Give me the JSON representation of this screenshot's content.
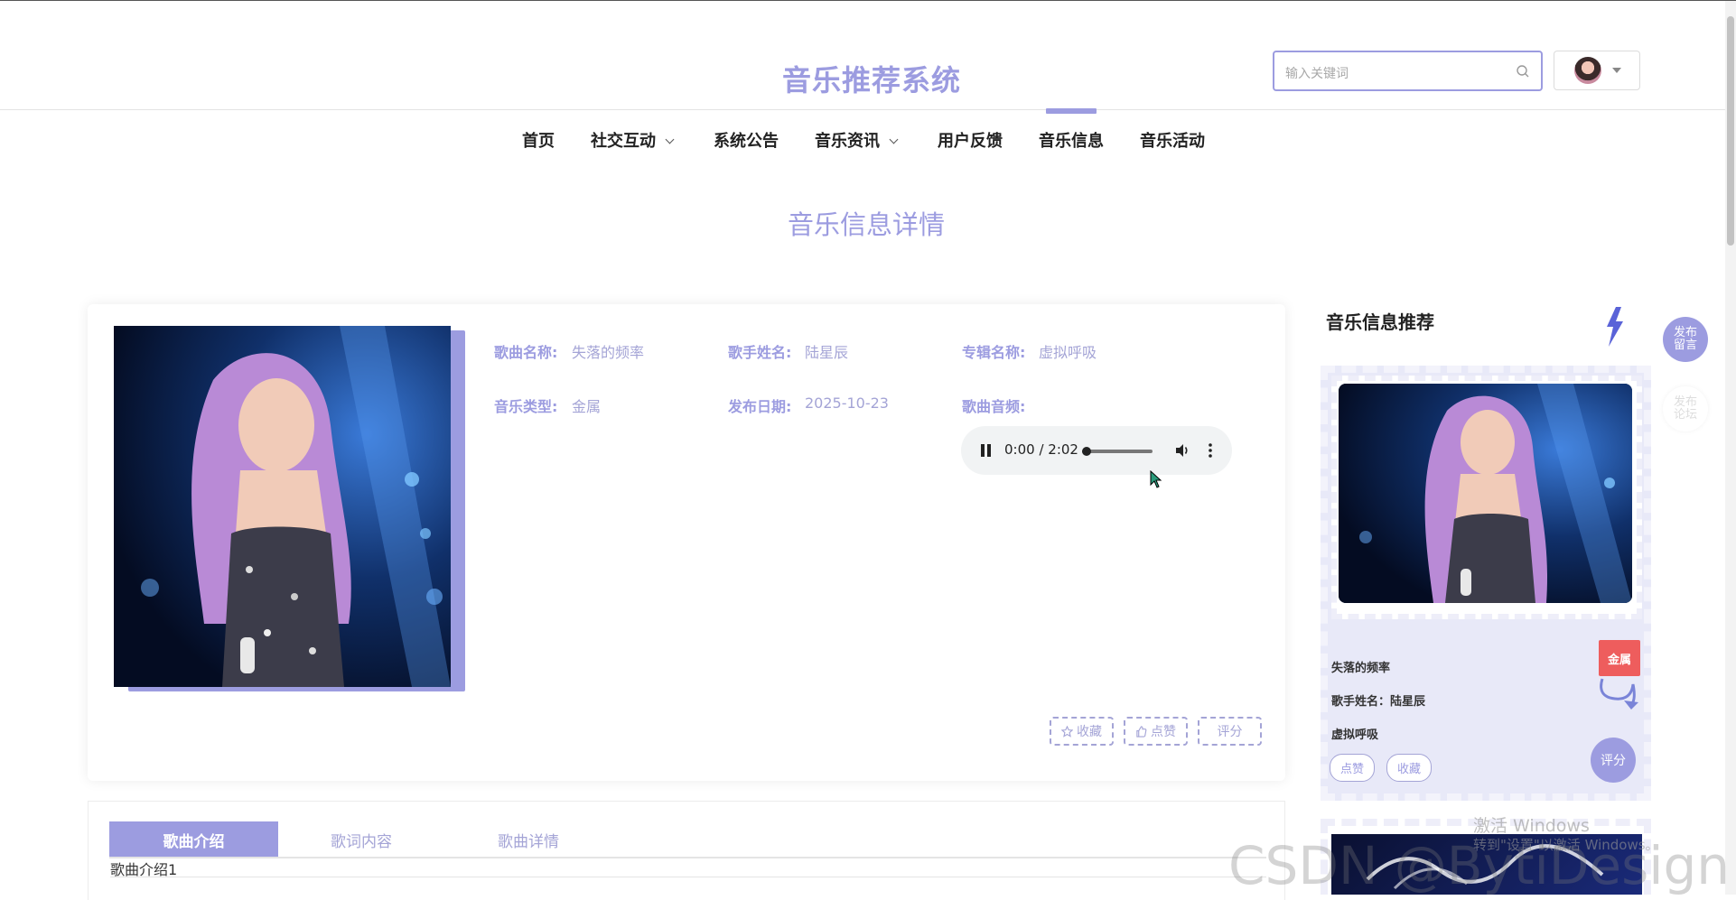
{
  "header": {
    "site_title": "音乐推荐系统",
    "search_placeholder": "输入关键词"
  },
  "nav": {
    "items": [
      {
        "label": "首页",
        "dropdown": false
      },
      {
        "label": "社交互动",
        "dropdown": true
      },
      {
        "label": "系统公告",
        "dropdown": false
      },
      {
        "label": "音乐资讯",
        "dropdown": true
      },
      {
        "label": "用户反馈",
        "dropdown": false
      },
      {
        "label": "音乐信息",
        "dropdown": false,
        "active": true
      },
      {
        "label": "音乐活动",
        "dropdown": false
      }
    ]
  },
  "page": {
    "heading": "音乐信息详情"
  },
  "detail": {
    "song_name_label": "歌曲名称:",
    "song_name": "失落的频率",
    "singer_label": "歌手姓名:",
    "singer": "陆星辰",
    "album_label": "专辑名称:",
    "album": "虚拟呼吸",
    "genre_label": "音乐类型:",
    "genre": "金属",
    "release_label": "发布日期:",
    "release_date": "2025-10-23",
    "audio_label": "歌曲音频:",
    "audio_time": "0:00 / 2:02",
    "actions": {
      "favorite": "收藏",
      "like": "点赞",
      "rate": "评分"
    }
  },
  "tabs": {
    "items": [
      "歌曲介绍",
      "歌词内容",
      "歌曲详情"
    ],
    "active_index": 0,
    "content": "歌曲介绍1"
  },
  "sidebar": {
    "title": "音乐信息推荐",
    "card": {
      "song_name": "失落的频率",
      "singer_line": "歌手姓名：陆星辰",
      "album": "虚拟呼吸",
      "genre_tag": "金属",
      "like": "点赞",
      "favorite": "收藏",
      "rate": "评分"
    }
  },
  "float_buttons": {
    "post_message": "发布留言",
    "post_forum": "发布论坛"
  },
  "watermarks": {
    "windows_line1": "激活 Windows",
    "windows_line2": "转到\"设置\"以激活 Windows。",
    "csdn": "CSDN @BytiDesign"
  },
  "colors": {
    "accent": "#9c9ce0",
    "accent_light": "#e8e9f8",
    "tag_red": "#ee5d5d"
  }
}
